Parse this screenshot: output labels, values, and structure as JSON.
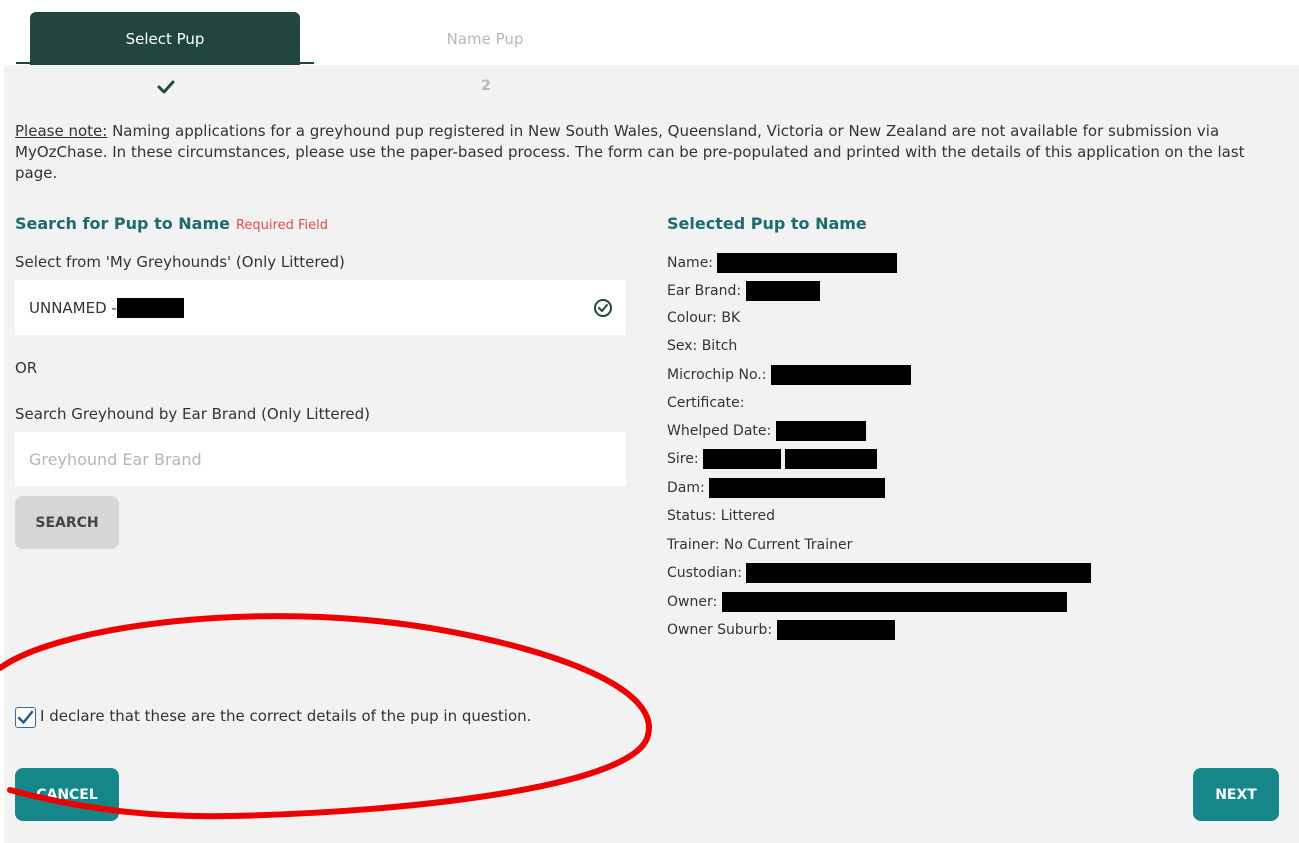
{
  "tabs": [
    {
      "label": "Select Pup",
      "active": true
    },
    {
      "label": "Name Pup",
      "active": false
    }
  ],
  "steps": {
    "step2": "2"
  },
  "note": {
    "prefix": "Please note:",
    "text": " Naming applications for a greyhound pup registered in New South Wales, Queensland, Victoria or New Zealand are not available for submission via MyOzChase. In these circumstances, please use the paper-based process. The form can be pre-populated and printed with the details of this application on the last page."
  },
  "search": {
    "title": "Search for Pup to Name",
    "required": "Required Field",
    "select_label": "Select from 'My Greyhounds' (Only Littered)",
    "selected_value": "UNNAMED - ",
    "or_label": "OR",
    "ear_label": "Search Greyhound by Ear Brand (Only Littered)",
    "ear_placeholder": "Greyhound Ear Brand",
    "search_button": "SEARCH"
  },
  "selected": {
    "title": "Selected Pup to Name",
    "name_label": "Name:",
    "ear_brand_label": "Ear Brand:",
    "colour": "Colour: BK",
    "sex": "Sex: Bitch",
    "microchip_label": "Microchip No.:",
    "certificate": "Certificate:",
    "whelped_label": "Whelped Date:",
    "sire_label": "Sire:",
    "dam_label": "Dam:",
    "status": "Status: Littered",
    "trainer": "Trainer: No Current Trainer",
    "custodian_label": "Custodian:",
    "owner_label": "Owner:",
    "owner_suburb_label": "Owner Suburb:"
  },
  "declaration": {
    "text": "I declare that these are the correct details of the pup in question.",
    "checked": true
  },
  "buttons": {
    "cancel": "CANCEL",
    "next": "NEXT"
  },
  "colors": {
    "tab_active": "#21463f",
    "accent_teal": "#15868a",
    "heading_teal": "#1b6b70",
    "required_red": "#e24b4b",
    "annotation_red": "#ee0000"
  }
}
